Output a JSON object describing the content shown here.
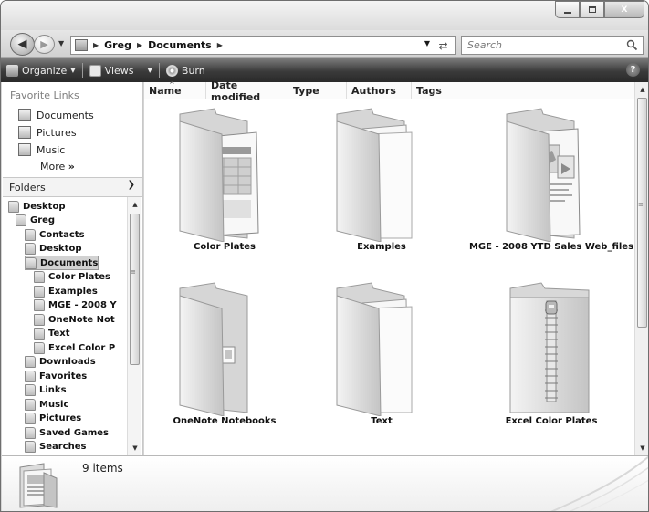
{
  "window": {
    "controls": {
      "minimize": "minimize",
      "maximize": "maximize",
      "close": "X"
    }
  },
  "address": {
    "crumbs": [
      "Greg",
      "Documents"
    ],
    "search_placeholder": "Search"
  },
  "toolbar": {
    "organize": "Organize",
    "views": "Views",
    "burn": "Burn",
    "help": "?"
  },
  "navpane": {
    "favorite_links_title": "Favorite Links",
    "favorites": [
      "Documents",
      "Pictures",
      "Music"
    ],
    "more": "More",
    "more_glyph": "»",
    "folders_title": "Folders",
    "tree": [
      {
        "label": "Desktop",
        "level": 0
      },
      {
        "label": "Greg",
        "level": 1
      },
      {
        "label": "Contacts",
        "level": 2
      },
      {
        "label": "Desktop",
        "level": 2
      },
      {
        "label": "Documents",
        "level": 2,
        "selected": true
      },
      {
        "label": "Color Plates",
        "level": 3
      },
      {
        "label": "Examples",
        "level": 3
      },
      {
        "label": "MGE - 2008 Y",
        "level": 3
      },
      {
        "label": "OneNote Not",
        "level": 3
      },
      {
        "label": "Text",
        "level": 3
      },
      {
        "label": "Excel Color P",
        "level": 3
      },
      {
        "label": "Downloads",
        "level": 2
      },
      {
        "label": "Favorites",
        "level": 2
      },
      {
        "label": "Links",
        "level": 2
      },
      {
        "label": "Music",
        "level": 2
      },
      {
        "label": "Pictures",
        "level": 2
      },
      {
        "label": "Saved Games",
        "level": 2
      },
      {
        "label": "Searches",
        "level": 2
      }
    ]
  },
  "columns": [
    "Name",
    "Date modified",
    "Type",
    "Authors",
    "Tags"
  ],
  "items": [
    {
      "label": "Color Plates",
      "kind": "folder-with-doc"
    },
    {
      "label": "Examples",
      "kind": "folder-pages"
    },
    {
      "label": "MGE - 2008 YTD Sales Web_files",
      "kind": "folder-with-paper"
    },
    {
      "label": "OneNote Notebooks",
      "kind": "folder-with-note"
    },
    {
      "label": "Text",
      "kind": "folder-pages"
    },
    {
      "label": "Excel Color Plates",
      "kind": "zip-folder"
    }
  ],
  "details": {
    "count": "9 items"
  },
  "colors": {
    "command_bar": "#3a3a3a",
    "selection": "#d2d2d2",
    "folder_light": "#f2f2f2",
    "folder_dark": "#b4b4b4"
  }
}
